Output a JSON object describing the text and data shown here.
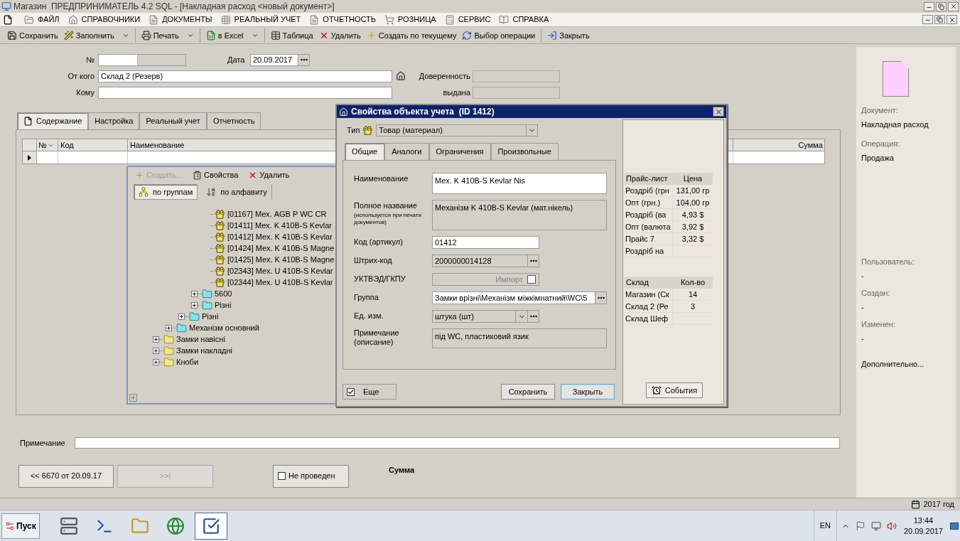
{
  "window": {
    "title": "Магазин  ПРЕДПРИНИМАТЕЛЬ 4.2 SQL - [Накладная расход <новый документ>]"
  },
  "menu": [
    {
      "label": "ФАЙЛ"
    },
    {
      "label": "СПРАВОЧНИКИ"
    },
    {
      "label": "ДОКУМЕНТЫ"
    },
    {
      "label": "РЕАЛЬНЫЙ УЧЕТ"
    },
    {
      "label": "ОТЧЕТНОСТЬ"
    },
    {
      "label": "РОЗНИЦА"
    },
    {
      "label": "СЕРВИС"
    },
    {
      "label": "СПРАВКА"
    }
  ],
  "toolbar": [
    {
      "label": "Сохранить",
      "dropdown": false,
      "separator_before": false
    },
    {
      "label": "Заполнить",
      "dropdown": true,
      "separator_before": false
    },
    {
      "label": "Печать",
      "dropdown": true,
      "separator_before": true
    },
    {
      "label": "в Excel",
      "dropdown": true,
      "separator_before": true
    },
    {
      "label": "Таблица",
      "dropdown": false,
      "separator_before": true
    },
    {
      "label": "Удалить",
      "dropdown": false,
      "separator_before": false
    },
    {
      "label": "Создать по текущему",
      "dropdown": false,
      "separator_before": false
    },
    {
      "label": "Выбор операции",
      "dropdown": false,
      "separator_before": false
    },
    {
      "label": "Закрыть",
      "dropdown": false,
      "separator_before": true
    }
  ],
  "header": {
    "number": {
      "label": "№"
    },
    "date": {
      "label": "Дата",
      "value": "20.09.2017"
    },
    "from": {
      "label": "От кого",
      "value": "Склад 2 (Резерв)"
    },
    "to": {
      "label": "Кому"
    },
    "proxy": {
      "label": "Доверенность"
    },
    "issued": {
      "label": "выдана"
    }
  },
  "doc_tabs": [
    {
      "label": "Содержание",
      "selected": true
    },
    {
      "label": "Настройка",
      "selected": false
    },
    {
      "label": "Реальный учет",
      "selected": false
    },
    {
      "label": "Отчетность",
      "selected": false
    }
  ],
  "grid": {
    "columns": [
      "№",
      "Код",
      "Наименование",
      "Сумма"
    ]
  },
  "note": {
    "label": "Примечание"
  },
  "footer": {
    "prev": {
      "label": "<< 6670 от 20.09.17",
      "disabled": false
    },
    "next": {
      "label": ">>|",
      "disabled": true
    },
    "posted": {
      "label": "Не проведен",
      "checked": false
    },
    "sum_label": "Сумма"
  },
  "info_panel": {
    "top": [
      {
        "label": "Документ:",
        "value": "Накладная расход"
      },
      {
        "label": "Операция:",
        "value": "Продажа"
      }
    ],
    "bottom": [
      {
        "label": "Пользователь:",
        "value": "-"
      },
      {
        "label": "Создан:",
        "value": "-"
      },
      {
        "label": "Изменен:",
        "value": "-"
      }
    ],
    "more": "Дополнительно..."
  },
  "status_bar": {
    "year": "2017 год"
  },
  "picker": {
    "actions": [
      {
        "label": "Создать...",
        "disabled": true
      },
      {
        "label": "Свойства",
        "disabled": false
      },
      {
        "label": "Удалить",
        "disabled": false
      }
    ],
    "views": [
      {
        "label": "по группам",
        "selected": true
      },
      {
        "label": "по алфавиту",
        "selected": false
      }
    ],
    "tree": [
      {
        "children": [
          {
            "children": [
              {
                "children": [
                  {
                    "children": [
                      {
                        "kind": "item",
                        "label": "[01167] Мех. AGB P WC CR"
                      },
                      {
                        "kind": "item",
                        "label": "[01411] Мех. K 410B-S Kevlar"
                      },
                      {
                        "kind": "item",
                        "label": "[01412] Мех. K 410B-S Kevlar"
                      },
                      {
                        "kind": "item",
                        "label": "[01424] Мех. K 410B-S Magne"
                      },
                      {
                        "kind": "item",
                        "label": "[01425] Мех. K 410B-S Magne"
                      },
                      {
                        "kind": "item",
                        "label": "[02343] Мех. U 410B-S Kevlar"
                      },
                      {
                        "kind": "item",
                        "label": "[02344] Мех. U 410B-S Kevlar"
                      }
                    ]
                  },
                  {
                    "kind": "folder",
                    "label": "5600",
                    "expanded": false
                  },
                  {
                    "kind": "folder",
                    "label": "Різні",
                    "expanded": false
                  }
                ]
              },
              {
                "kind": "folder",
                "label": "Різні",
                "expanded": false
              }
            ]
          },
          {
            "kind": "folder",
            "label": "Механізм основний",
            "expanded": false
          }
        ]
      },
      {
        "kind": "folder",
        "label": "Замки навісні",
        "expanded": false
      },
      {
        "kind": "folder",
        "label": "Замки накладні",
        "expanded": false
      },
      {
        "kind": "folder",
        "label": "Кноби",
        "expanded": false
      }
    ]
  },
  "dialog": {
    "title": "Свойства объекта учета  (ID 1412)",
    "type": {
      "label": "Тип",
      "value": "Товар (материал)"
    },
    "tabs": [
      {
        "label": "Общие",
        "selected": true
      },
      {
        "label": "Аналоги",
        "selected": false
      },
      {
        "label": "Ограничения",
        "selected": false
      },
      {
        "label": "Произвольные",
        "selected": false
      }
    ],
    "fields": [
      {
        "kind": "area",
        "label": "Наименование",
        "value": "Мех. K 410B-S Kevlar Nis",
        "readonly": false
      },
      {
        "kind": "area",
        "label": "Полное название",
        "hint": "(используется при печати документов)",
        "value": "Механізм K 410B-S Kevlar (мат.нікель)",
        "readonly": true
      },
      {
        "kind": "text",
        "label": "Код (артикул)",
        "value": "01412",
        "readonly": false
      },
      {
        "kind": "picker",
        "label": "Штрих-код",
        "value": "2000000014128",
        "readonly": true,
        "wide": false
      },
      {
        "kind": "import",
        "label": "УКТВЭД/ГКПУ",
        "checkbox_label": "Импорт",
        "checked": false
      },
      {
        "kind": "picker",
        "label": "Группа",
        "value": "Замки врізні\\Механізм міжкімнатний\\WC\\5",
        "readonly": false,
        "wide": true
      },
      {
        "kind": "combo",
        "label": "Ед. изм.",
        "value": "штука (шт)"
      },
      {
        "kind": "memo",
        "label": "Примечание (описание)",
        "value": "під WC, пластиковий язик"
      }
    ],
    "more": {
      "label": "Еще",
      "checked": true
    },
    "buttons": [
      {
        "label": "Сохранить",
        "default": false
      },
      {
        "label": "Закрыть",
        "default": true
      }
    ],
    "prices": {
      "columns": [
        "Прайс-лист",
        "Цена"
      ],
      "rows": [
        {
          "name": "Роздріб (грн",
          "price": "131,00 гр"
        },
        {
          "name": "Опт (грн.)",
          "price": "104,00 гр"
        },
        {
          "name": "Роздріб (ва",
          "price": "4,93 $"
        },
        {
          "name": "Опт (валюта",
          "price": "3,92 $"
        },
        {
          "name": "Прайс 7",
          "price": "3,32 $"
        },
        {
          "name": "Роздріб на"
        }
      ]
    },
    "stock": {
      "columns": [
        "Склад",
        "Кол-во"
      ],
      "rows": [
        {
          "name": "Магазин (Ск",
          "qty": "14"
        },
        {
          "name": "Склад 2 (Ре",
          "qty": "3"
        },
        {
          "name": "Склад Шеф"
        }
      ]
    },
    "events": "События"
  },
  "taskbar": {
    "start": "Пуск",
    "apps": [
      {
        "selected": false
      },
      {
        "selected": false
      },
      {
        "selected": false
      },
      {
        "selected": false
      },
      {
        "selected": true
      }
    ],
    "language": "EN",
    "time": "13:44",
    "date": "20.09.2017"
  }
}
